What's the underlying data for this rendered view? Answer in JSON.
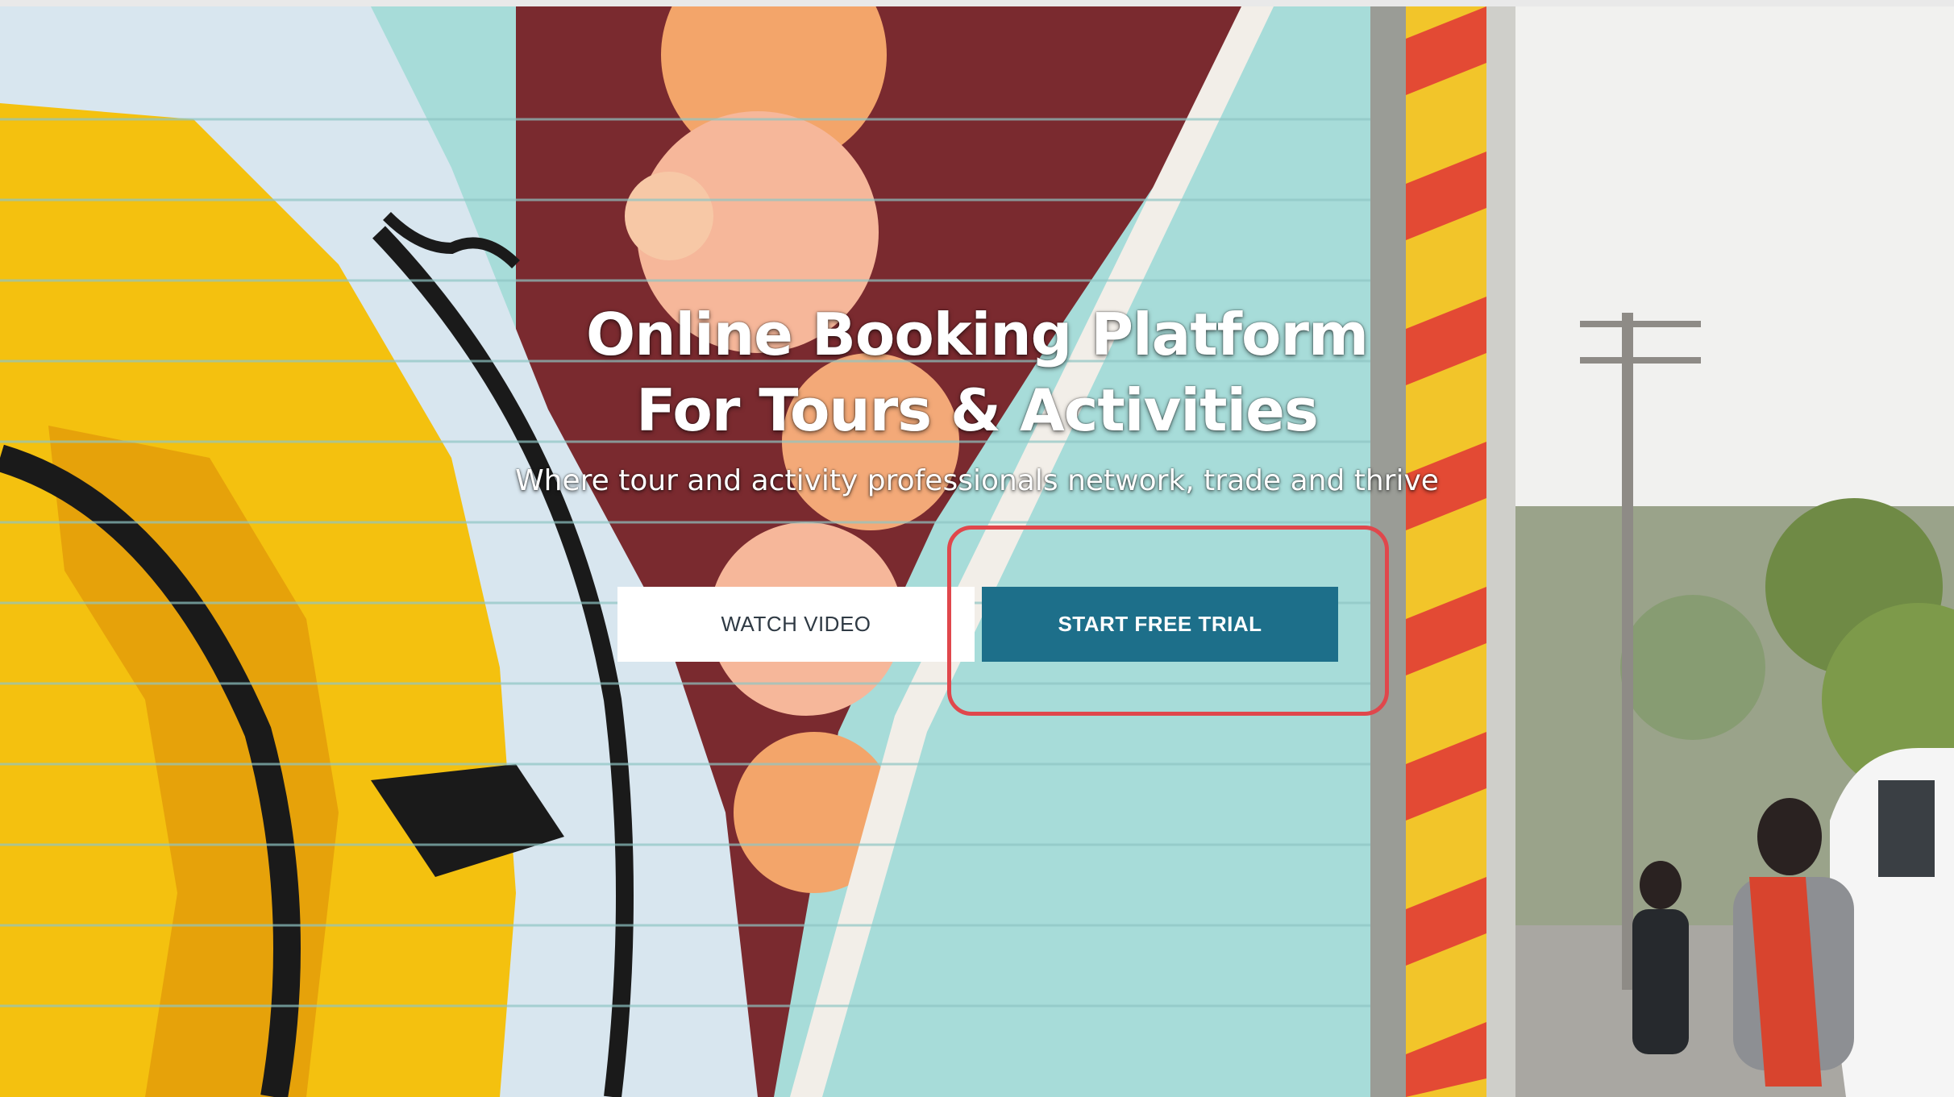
{
  "hero": {
    "headline_line1": "Online Booking Platform",
    "headline_line2": "For Tours & Activities",
    "subheadline": "Where tour and activity professionals network, trade and thrive"
  },
  "cta": {
    "watch_video_label": "WATCH VIDEO",
    "start_trial_label": "START FREE TRIAL"
  },
  "colors": {
    "primary_button": "#1d6f8a",
    "secondary_button": "#ffffff",
    "highlight": "#e0474c"
  },
  "icons": []
}
